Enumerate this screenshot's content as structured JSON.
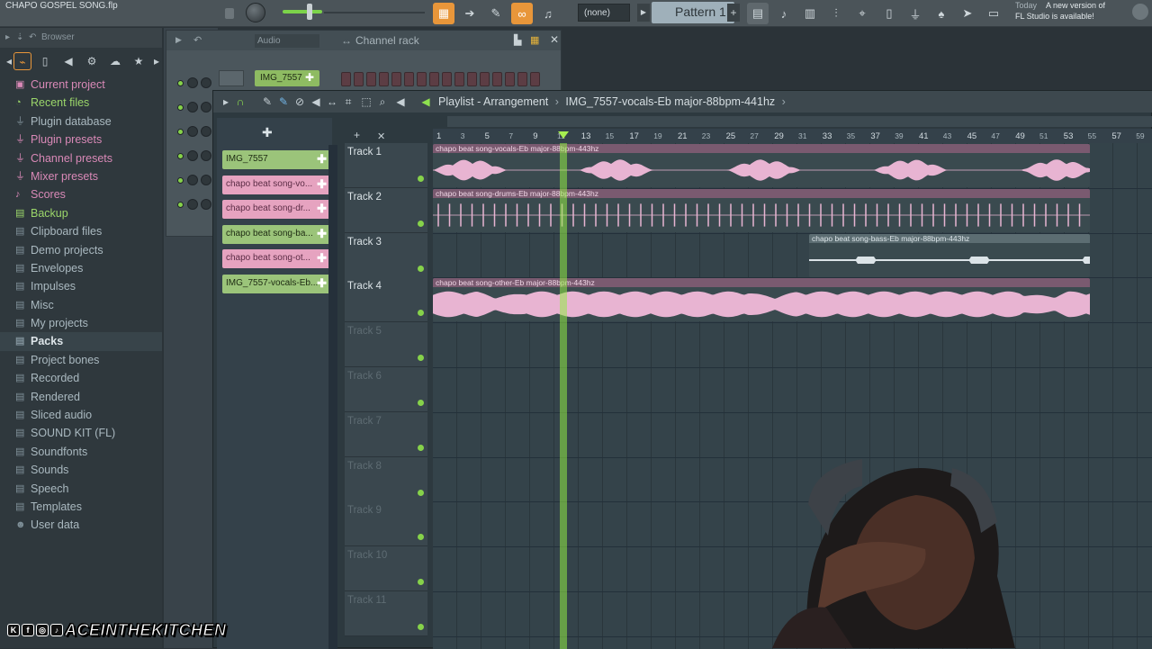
{
  "app": {
    "project_title": "CHAPO GOSPEL SONG.flp",
    "snap_value": "(none)",
    "pattern_label": "Pattern 1",
    "news_today": "Today",
    "news_message": "A new version of",
    "news_message2": "FL Studio is available!"
  },
  "browser": {
    "title": "Browser",
    "items": [
      {
        "label": "Current project",
        "icon": "project-icon",
        "style": "pink"
      },
      {
        "label": "Recent files",
        "icon": "clock-icon",
        "style": "green"
      },
      {
        "label": "Plugin database",
        "icon": "plug-icon",
        "style": "normal"
      },
      {
        "label": "Plugin presets",
        "icon": "plug-icon",
        "style": "pink"
      },
      {
        "label": "Channel presets",
        "icon": "plug-icon",
        "style": "pink"
      },
      {
        "label": "Mixer presets",
        "icon": "plug-icon",
        "style": "pink"
      },
      {
        "label": "Scores",
        "icon": "music-icon",
        "style": "pink"
      },
      {
        "label": "Backup",
        "icon": "folder-icon",
        "style": "green"
      },
      {
        "label": "Clipboard files",
        "icon": "folder-icon",
        "style": "normal"
      },
      {
        "label": "Demo projects",
        "icon": "folder-icon",
        "style": "normal"
      },
      {
        "label": "Envelopes",
        "icon": "folder-icon",
        "style": "normal"
      },
      {
        "label": "Impulses",
        "icon": "folder-icon",
        "style": "normal"
      },
      {
        "label": "Misc",
        "icon": "folder-icon",
        "style": "normal"
      },
      {
        "label": "My projects",
        "icon": "folder-icon",
        "style": "normal"
      },
      {
        "label": "Packs",
        "icon": "folder-icon",
        "style": "highlight"
      },
      {
        "label": "Project bones",
        "icon": "folder-icon",
        "style": "normal"
      },
      {
        "label": "Recorded",
        "icon": "folder-icon",
        "style": "normal"
      },
      {
        "label": "Rendered",
        "icon": "folder-icon",
        "style": "normal"
      },
      {
        "label": "Sliced audio",
        "icon": "folder-icon",
        "style": "normal"
      },
      {
        "label": "SOUND KIT (FL)",
        "icon": "folder-icon",
        "style": "normal"
      },
      {
        "label": "Soundfonts",
        "icon": "folder-icon",
        "style": "normal"
      },
      {
        "label": "Sounds",
        "icon": "folder-icon",
        "style": "normal"
      },
      {
        "label": "Speech",
        "icon": "folder-icon",
        "style": "normal"
      },
      {
        "label": "Templates",
        "icon": "folder-icon",
        "style": "normal"
      },
      {
        "label": "User data",
        "icon": "user-icon",
        "style": "normal"
      }
    ]
  },
  "channel_rack": {
    "filter": "Audio",
    "title": "Channel rack",
    "channel_name": "IMG_7557"
  },
  "playlist": {
    "title_prefix": "Playlist - Arrangement",
    "title_pattern": "IMG_7557-vocals-Eb major-88bpm-441hz",
    "picker_items": [
      {
        "label": "IMG_7557",
        "style": "green"
      },
      {
        "label": "chapo beat song-vo...",
        "style": "pink"
      },
      {
        "label": "chapo beat song-dr...",
        "style": "pink"
      },
      {
        "label": "chapo beat song-ba...",
        "style": "green"
      },
      {
        "label": "chapo beat song-ot...",
        "style": "pink"
      },
      {
        "label": "IMG_7557-vocals-Eb...",
        "style": "green"
      }
    ],
    "bar_numbers": [
      "1",
      "3",
      "5",
      "7",
      "9",
      "11",
      "13",
      "15",
      "17",
      "19",
      "21",
      "23",
      "25",
      "27",
      "29",
      "31",
      "33",
      "35",
      "37",
      "39",
      "41",
      "43",
      "45",
      "47",
      "49",
      "51",
      "53",
      "55",
      "57",
      "59"
    ],
    "tracks": [
      {
        "label": "Track 1",
        "empty": false
      },
      {
        "label": "Track 2",
        "empty": false
      },
      {
        "label": "Track 3",
        "empty": false
      },
      {
        "label": "Track 4",
        "empty": false
      },
      {
        "label": "Track 5",
        "empty": true
      },
      {
        "label": "Track 6",
        "empty": true
      },
      {
        "label": "Track 7",
        "empty": true
      },
      {
        "label": "Track 8",
        "empty": true
      },
      {
        "label": "Track 9",
        "empty": true
      },
      {
        "label": "Track 10",
        "empty": true
      },
      {
        "label": "Track 11",
        "empty": true
      }
    ],
    "clips": [
      {
        "name": "chapo beat song-vocals-Eb major-88bpm-443hz",
        "track": 1,
        "kind": "vocals"
      },
      {
        "name": "chapo beat song-drums-Eb major-88bpm-443hz",
        "track": 2,
        "kind": "drums"
      },
      {
        "name": "chapo beat song-bass-Eb major-88bpm-443hz",
        "track": 3,
        "kind": "bass"
      },
      {
        "name": "chapo beat song-other-Eb major-88bpm-443hz",
        "track": 4,
        "kind": "other"
      }
    ]
  },
  "watermark": {
    "text": "ACEINTHEKITCHEN"
  },
  "colors": {
    "accent_orange": "#e8963a",
    "playhead_green": "#92eb46",
    "clip_pink": "#e6a3c0",
    "wave_pink": "#e8b4d2"
  }
}
